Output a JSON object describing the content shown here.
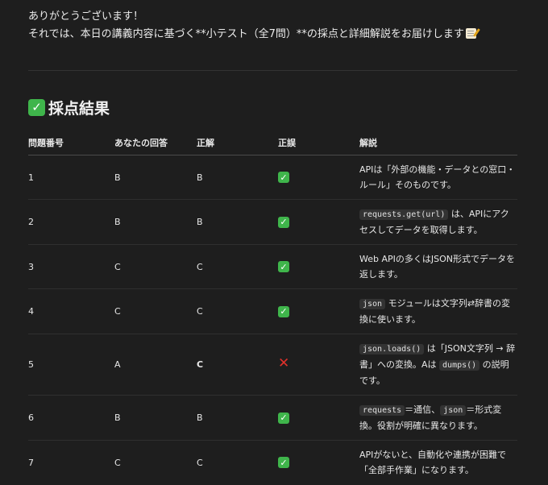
{
  "intro": {
    "line1": "ありがとうございます！",
    "line2": "それでは、本日の講義内容に基づく**小テスト（全7問）**の採点と詳細解説をお届けします",
    "line2_icon": "memo-icon"
  },
  "section": {
    "title": "採点結果",
    "title_icon": "check-mark-button-icon"
  },
  "table": {
    "headers": [
      "問題番号",
      "あなたの回答",
      "正解",
      "正誤",
      "解説"
    ],
    "rows": [
      {
        "no": "1",
        "answer": "B",
        "correct": "B",
        "result": "correct",
        "expl": [
          {
            "t": "APIは「外部の機能・データとの窓口・ルール」そのものです。"
          }
        ]
      },
      {
        "no": "2",
        "answer": "B",
        "correct": "B",
        "result": "correct",
        "expl": [
          {
            "c": "requests.get(url)"
          },
          {
            "t": " は、APIにアクセスしてデータを取得します。"
          }
        ]
      },
      {
        "no": "3",
        "answer": "C",
        "correct": "C",
        "result": "correct",
        "expl": [
          {
            "t": "Web APIの多くはJSON形式でデータを返します。"
          }
        ]
      },
      {
        "no": "4",
        "answer": "C",
        "correct": "C",
        "result": "correct",
        "expl": [
          {
            "c": "json"
          },
          {
            "t": " モジュールは文字列⇄辞書の変換に使います。"
          }
        ]
      },
      {
        "no": "5",
        "answer": "A",
        "correct": "C",
        "result": "incorrect",
        "correct_bold": true,
        "expl": [
          {
            "c": "json.loads()"
          },
          {
            "t": " は「JSON文字列 → 辞書」への変換。Aは "
          },
          {
            "c": "dumps()"
          },
          {
            "t": " の説明です。"
          }
        ]
      },
      {
        "no": "6",
        "answer": "B",
        "correct": "B",
        "result": "correct",
        "expl": [
          {
            "c": "requests"
          },
          {
            "t": "＝通信、"
          },
          {
            "c": "json"
          },
          {
            "t": "＝形式変換。役割が明確に異なります。"
          }
        ]
      },
      {
        "no": "7",
        "answer": "C",
        "correct": "C",
        "result": "correct",
        "expl": [
          {
            "t": "APIがないと、自動化や連携が困難で「全部手作業」になります。"
          }
        ]
      }
    ]
  },
  "icons": {
    "correct": "check-mark-button-icon",
    "incorrect": "cross-mark-icon"
  },
  "colors": {
    "background": "#1e1e1e",
    "check_green": "#3fb54b",
    "cross_red": "#e0312b"
  }
}
